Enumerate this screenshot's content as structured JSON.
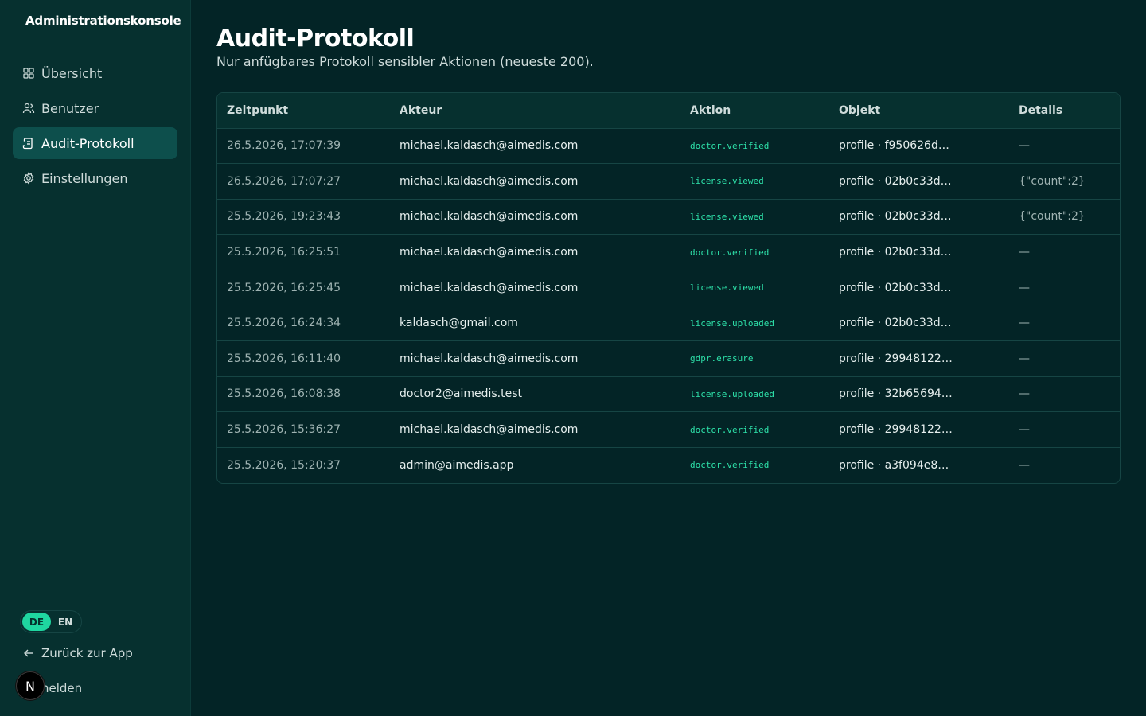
{
  "app": {
    "title": "Administrationskonsole"
  },
  "sidebar": {
    "items": [
      {
        "label": "Übersicht",
        "icon": "grid-icon",
        "active": false
      },
      {
        "label": "Benutzer",
        "icon": "users-icon",
        "active": false
      },
      {
        "label": "Audit-Protokoll",
        "icon": "log-icon",
        "active": true
      },
      {
        "label": "Einstellungen",
        "icon": "gear-icon",
        "active": false
      }
    ],
    "lang": {
      "de": "DE",
      "en": "EN",
      "selected": "DE"
    },
    "back_label": "Zurück zur App",
    "logout_label": "nelden",
    "dev_badge": "N"
  },
  "page": {
    "title": "Audit-Protokoll",
    "subtitle": "Nur anfügbares Protokoll sensibler Aktionen (neueste 200)."
  },
  "table": {
    "columns": [
      "Zeitpunkt",
      "Akteur",
      "Aktion",
      "Objekt",
      "Details"
    ],
    "rows": [
      [
        "26.5.2026, 17:07:39",
        "michael.kaldasch@aimedis.com",
        "doctor.verified",
        "profile · f950626d…",
        "—"
      ],
      [
        "26.5.2026, 17:07:27",
        "michael.kaldasch@aimedis.com",
        "license.viewed",
        "profile · 02b0c33d…",
        "{\"count\":2}"
      ],
      [
        "25.5.2026, 19:23:43",
        "michael.kaldasch@aimedis.com",
        "license.viewed",
        "profile · 02b0c33d…",
        "{\"count\":2}"
      ],
      [
        "25.5.2026, 16:25:51",
        "michael.kaldasch@aimedis.com",
        "doctor.verified",
        "profile · 02b0c33d…",
        "—"
      ],
      [
        "25.5.2026, 16:25:45",
        "michael.kaldasch@aimedis.com",
        "license.viewed",
        "profile · 02b0c33d…",
        "—"
      ],
      [
        "25.5.2026, 16:24:34",
        "kaldasch@gmail.com",
        "license.uploaded",
        "profile · 02b0c33d…",
        "—"
      ],
      [
        "25.5.2026, 16:11:40",
        "michael.kaldasch@aimedis.com",
        "gdpr.erasure",
        "profile · 29948122…",
        "—"
      ],
      [
        "25.5.2026, 16:08:38",
        "doctor2@aimedis.test",
        "license.uploaded",
        "profile · 32b65694…",
        "—"
      ],
      [
        "25.5.2026, 15:36:27",
        "michael.kaldasch@aimedis.com",
        "doctor.verified",
        "profile · 29948122…",
        "—"
      ],
      [
        "25.5.2026, 15:20:37",
        "admin@aimedis.app",
        "doctor.verified",
        "profile · a3f094e8…",
        "—"
      ]
    ]
  },
  "colors": {
    "background": "#032426",
    "sidebar": "#06302f",
    "accent": "#1fd6a0",
    "action_text": "#2ee2aa"
  }
}
